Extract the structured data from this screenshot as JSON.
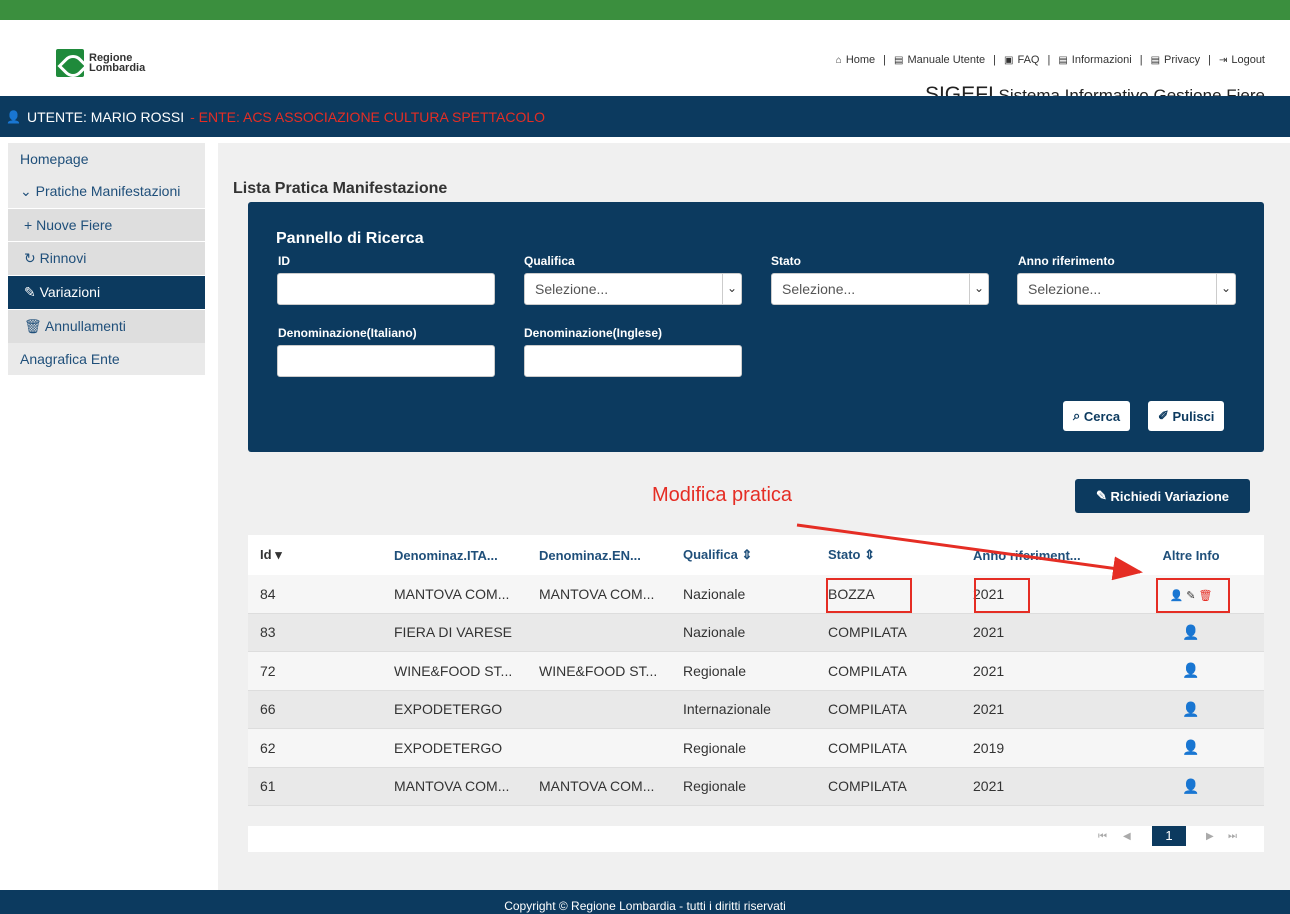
{
  "header": {
    "logo_line1": "Regione",
    "logo_line2": "Lombardia",
    "links": [
      {
        "icon": "home-icon",
        "glyph": "⌂",
        "label": "Home"
      },
      {
        "icon": "document-icon",
        "glyph": "▤",
        "label": "Manuale Utente"
      },
      {
        "icon": "faq-icon",
        "glyph": "▣",
        "label": "FAQ"
      },
      {
        "icon": "document-icon",
        "glyph": "▤",
        "label": "Informazioni"
      },
      {
        "icon": "document-icon",
        "glyph": "▤",
        "label": "Privacy"
      },
      {
        "icon": "logout-icon",
        "glyph": "⇥",
        "label": "Logout"
      }
    ],
    "app_acronym": "SIGEFI",
    "app_name": "Sistema Informativo Gestione Fiere"
  },
  "userbar": {
    "user": "UTENTE: MARIO ROSSI",
    "ente": "- ENTE: ACS ASSOCIAZIONE CULTURA SPETTACOLO"
  },
  "sidebar": {
    "homepage": "Homepage",
    "pratiche": "Pratiche Manifestazioni",
    "sub": [
      {
        "icon": "+",
        "label": "Nuove Fiere"
      },
      {
        "icon": "↻",
        "label": "Rinnovi"
      },
      {
        "icon": "✎",
        "label": "Variazioni"
      },
      {
        "icon": "🗑",
        "label": "Annullamenti"
      }
    ],
    "anagrafica": "Anagrafica Ente"
  },
  "main": {
    "title": "Lista Pratica Manifestazione",
    "search": {
      "title": "Pannello di Ricerca",
      "id_label": "ID",
      "qualifica_label": "Qualifica",
      "qualifica_value": "Selezione...",
      "stato_label": "Stato",
      "stato_value": "Selezione...",
      "anno_label": "Anno riferimento",
      "anno_value": "Selezione...",
      "den_it_label": "Denominazione(Italiano)",
      "den_en_label": "Denominazione(Inglese)",
      "cerca": "Cerca",
      "pulisci": "Pulisci"
    },
    "richiedi": "Richiedi Variazione",
    "annotation": "Modifica pratica",
    "table": {
      "headers": [
        "Id",
        "Denominaz.ITA...",
        "Denominaz.EN...",
        "Qualifica",
        "Stato",
        "Anno riferiment...",
        "Altre Info"
      ],
      "rows": [
        [
          "84",
          "MANTOVA COM...",
          "MANTOVA COM...",
          "Nazionale",
          "BOZZA",
          "2021"
        ],
        [
          "83",
          "FIERA DI VARESE",
          "",
          "Nazionale",
          "COMPILATA",
          "2021"
        ],
        [
          "72",
          "WINE&FOOD ST...",
          "WINE&FOOD ST...",
          "Regionale",
          "COMPILATA",
          "2021"
        ],
        [
          "66",
          "EXPODETERGO",
          "",
          "Internazionale",
          "COMPILATA",
          "2021"
        ],
        [
          "62",
          "EXPODETERGO",
          "",
          "Regionale",
          "COMPILATA",
          "2019"
        ],
        [
          "61",
          "MANTOVA COM...",
          "MANTOVA COM...",
          "Regionale",
          "COMPILATA",
          "2021"
        ]
      ]
    },
    "pager": {
      "current": "1"
    }
  },
  "footer": "Copyright © Regione Lombardia - tutti i diritti riservati"
}
